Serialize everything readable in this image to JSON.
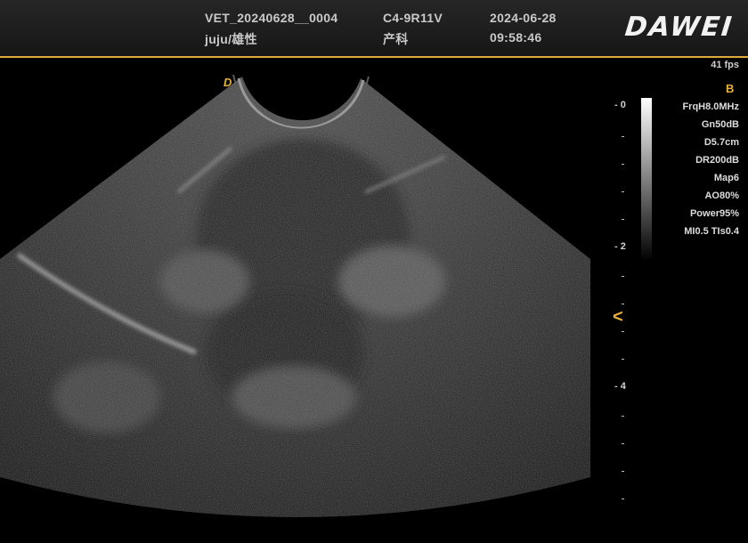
{
  "header": {
    "study_id": "VET_20240628__0004",
    "patient": "juju/雄性",
    "probe": "C4-9R11V",
    "department": "产科",
    "date": "2024-06-28",
    "time": "09:58:46",
    "logo": "DAWEI"
  },
  "status": {
    "fps": "41 fps",
    "mode": "B",
    "orientation_marker": "D"
  },
  "depth_scale": {
    "labels": [
      "0",
      "2",
      "4"
    ],
    "focus_marker": "<"
  },
  "params": [
    "FrqH8.0MHz",
    "Gn50dB",
    "D5.7cm",
    "DR200dB",
    "Map6",
    "AO80%",
    "Power95%",
    "MI0.5 TIs0.4"
  ],
  "colors": {
    "accent": "#e8b13c",
    "header_bg": "#1e1e1e",
    "text": "#c9c9c9"
  }
}
